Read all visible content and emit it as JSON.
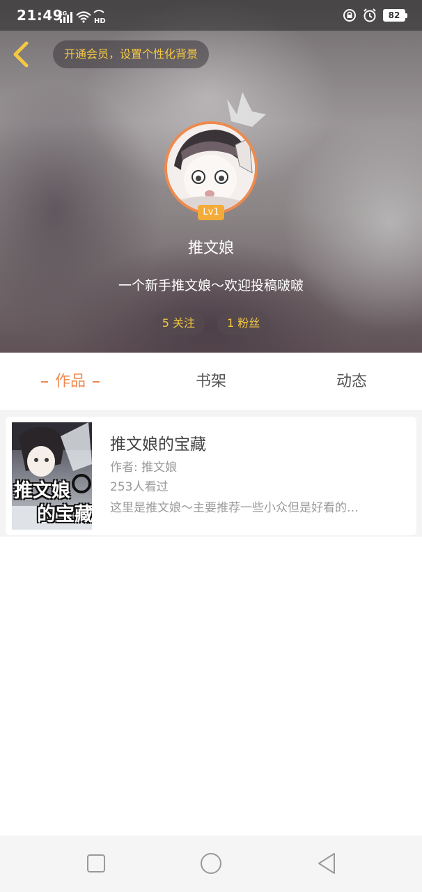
{
  "status_bar": {
    "time": "21:49",
    "battery": "82"
  },
  "header": {
    "vip_banner": "开通会员，设置个性化背景",
    "level": "Lv1",
    "username": "推文娘",
    "bio": "一个新手推文娘〜欢迎投稿啵啵",
    "following": "5 关注",
    "followers": "1 粉丝"
  },
  "tabs": [
    {
      "label": "作品",
      "active": true
    },
    {
      "label": "书架",
      "active": false
    },
    {
      "label": "动态",
      "active": false
    }
  ],
  "works": [
    {
      "cover_text_1": "推文娘",
      "cover_text_2": "的宝藏",
      "title": "推文娘的宝藏",
      "author": "作者: 推文娘",
      "views": "253人看过",
      "description": "这里是推文娘〜主要推荐一些小众但是好看的…"
    }
  ],
  "colors": {
    "accent": "#ee8a4e",
    "gold": "#f5c842",
    "level_badge": "#f4ab3a"
  },
  "icons": {
    "back": "chevron-left-icon",
    "crown": "crown-icon",
    "nav_recent": "square-icon",
    "nav_home": "circle-icon",
    "nav_back": "triangle-left-icon"
  }
}
